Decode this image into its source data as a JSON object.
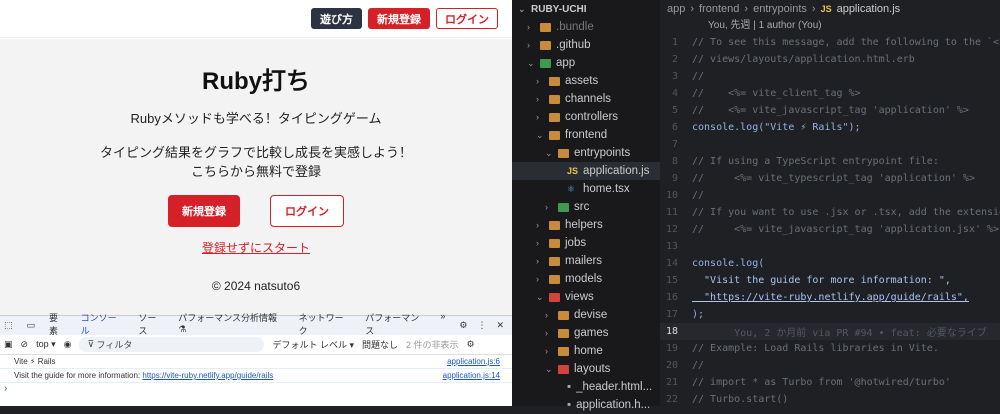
{
  "header": {
    "how_to": "遊び方",
    "signup": "新規登録",
    "login": "ログイン"
  },
  "main": {
    "title": "Ruby打ち",
    "subtitle": "Rubyメソッドも学べる！タイピングゲーム",
    "message_line1": "タイピング結果をグラフで比較し成長を実感しよう！",
    "message_line2": "こちらから無料で登録",
    "signup": "新規登録",
    "login": "ログイン",
    "guest": "登録せずにスタート",
    "footer": "© 2024 natsuto6"
  },
  "devtools": {
    "tabs": [
      "要素",
      "コンソール",
      "ソース",
      "パフォーマンス分析情報 ⚗",
      "ネットワーク",
      "パフォーマンス",
      "»"
    ],
    "context": "top ▾",
    "filter_placeholder": "フィルタ",
    "level": "デフォルト レベル ▾",
    "issues": "問題なし",
    "hidden": "2 件の非表示",
    "logs": [
      {
        "text": "Vite ⚡ Rails",
        "link": "",
        "source": "application.js:6"
      },
      {
        "text": "Visit the guide for more information:",
        "link": "https://vite-ruby.netlify.app/guide/rails",
        "source": "application.js:14"
      }
    ],
    "prompt": "›"
  },
  "explorer": {
    "root": "RUBY-UCHI",
    "items": [
      {
        "label": ".bundle",
        "depth": 1,
        "chev": "›"
      },
      {
        "label": ".github",
        "depth": 1,
        "chev": "›"
      },
      {
        "label": "app",
        "depth": 1,
        "chev": "⌄"
      },
      {
        "label": "assets",
        "depth": 2,
        "chev": "›"
      },
      {
        "label": "channels",
        "depth": 2,
        "chev": "›"
      },
      {
        "label": "controllers",
        "depth": 2,
        "chev": "›"
      },
      {
        "label": "frontend",
        "depth": 2,
        "chev": "⌄"
      },
      {
        "label": "entrypoints",
        "depth": 3,
        "chev": "⌄"
      },
      {
        "label": "application.js",
        "depth": 4,
        "chev": "",
        "icon": "JS"
      },
      {
        "label": "home.tsx",
        "depth": 4,
        "chev": "",
        "icon": "⚛"
      },
      {
        "label": "src",
        "depth": 3,
        "chev": "›"
      },
      {
        "label": "helpers",
        "depth": 2,
        "chev": "›"
      },
      {
        "label": "jobs",
        "depth": 2,
        "chev": "›"
      },
      {
        "label": "mailers",
        "depth": 2,
        "chev": "›"
      },
      {
        "label": "models",
        "depth": 2,
        "chev": "›"
      },
      {
        "label": "views",
        "depth": 2,
        "chev": "⌄"
      },
      {
        "label": "devise",
        "depth": 3,
        "chev": "›"
      },
      {
        "label": "games",
        "depth": 3,
        "chev": "›"
      },
      {
        "label": "home",
        "depth": 3,
        "chev": "›"
      },
      {
        "label": "layouts",
        "depth": 3,
        "chev": "⌄"
      },
      {
        "label": "_header.html...",
        "depth": 4,
        "chev": ""
      },
      {
        "label": "application.h...",
        "depth": 4,
        "chev": ""
      }
    ]
  },
  "breadcrumb": [
    "app",
    "frontend",
    "entrypoints",
    "application.js"
  ],
  "blame": "You, 先週 | 1 author (You)",
  "code": [
    {
      "n": "1",
      "t": "// To see this message, add the following to the `<h",
      "c": "cm"
    },
    {
      "n": "2",
      "t": "// views/layouts/application.html.erb",
      "c": "cm"
    },
    {
      "n": "3",
      "t": "//",
      "c": "cm"
    },
    {
      "n": "4",
      "t": "//    <%= vite_client_tag %>",
      "c": "cm"
    },
    {
      "n": "5",
      "t": "//    <%= vite_javascript_tag 'application' %>",
      "c": "cm"
    },
    {
      "n": "6",
      "t": "console.log(\"Vite ⚡ Rails\");",
      "c": "kw"
    },
    {
      "n": "7",
      "t": "",
      "c": "cm"
    },
    {
      "n": "8",
      "t": "// If using a TypeScript entrypoint file:",
      "c": "cm"
    },
    {
      "n": "9",
      "t": "//     <%= vite_typescript_tag 'application' %>",
      "c": "cm"
    },
    {
      "n": "10",
      "t": "//",
      "c": "cm"
    },
    {
      "n": "11",
      "t": "// If you want to use .jsx or .tsx, add the extensio",
      "c": "cm"
    },
    {
      "n": "12",
      "t": "//     <%= vite_javascript_tag 'application.jsx' %>",
      "c": "cm"
    },
    {
      "n": "13",
      "t": "",
      "c": "cm"
    },
    {
      "n": "14",
      "t": "console.log(",
      "c": "kw"
    },
    {
      "n": "15",
      "t": "  \"Visit the guide for more information: \",",
      "c": "str"
    },
    {
      "n": "16",
      "t": "  \"https://vite-ruby.netlify.app/guide/rails\",",
      "c": "str"
    },
    {
      "n": "17",
      "t": ");",
      "c": "kw"
    },
    {
      "n": "18",
      "t": "       You, 2 か月前 via PR #94 • feat: 必要なライブ",
      "c": "ghost"
    },
    {
      "n": "19",
      "t": "// Example: Load Rails libraries in Vite.",
      "c": "cm"
    },
    {
      "n": "20",
      "t": "//",
      "c": "cm"
    },
    {
      "n": "21",
      "t": "// import * as Turbo from '@hotwired/turbo'",
      "c": "cm"
    },
    {
      "n": "22",
      "t": "// Turbo.start()",
      "c": "cm"
    }
  ]
}
